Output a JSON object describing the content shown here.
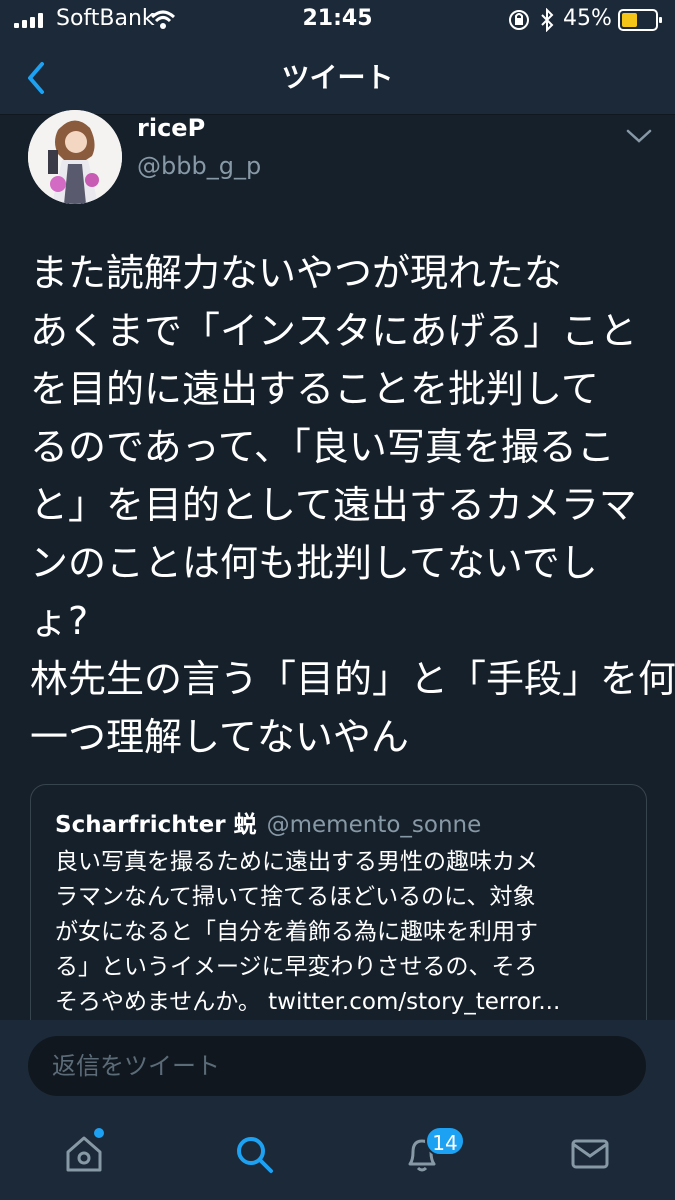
{
  "status_bar": {
    "carrier": "SoftBank",
    "time": "21:45",
    "battery": "45%"
  },
  "nav": {
    "title": "ツイート"
  },
  "tweet": {
    "display_name": "riceP",
    "handle": "@bbb_g_p",
    "lines": [
      "また読解力ないやつが現れたな",
      "あくまで「インスタにあげる」こと",
      "を目的に遠出することを批判して",
      "るのであって、「良い写真を撮るこ",
      "と」を目的として遠出するカメラマ",
      "ンのことは何も批判してないでし",
      "ょ?",
      "林先生の言う「目的」と「手段」を何",
      "一つ理解してないやん"
    ]
  },
  "quote": {
    "name": "Scharfrichter 蜕",
    "handle": "@memento_sonne",
    "lines": [
      "良い写真を撮るために遠出する男性の趣味カメ",
      "ラマンなんて掃いて捨てるほどいるのに、対象",
      "が女になると「自分を着飾る為に趣味を利用す",
      "る」というイメージに早変わりさせるの、そろ",
      "そろやめませんか。 twitter.com/story_terror..."
    ]
  },
  "composer": {
    "placeholder": "返信をツイート"
  },
  "tabs": {
    "notifications_count": "14"
  },
  "colors": {
    "background": "#15202b",
    "bar": "#1c2938",
    "accent": "#1da1f2",
    "muted": "#8899a6"
  },
  "icons": [
    "back-chevron-icon",
    "caret-down-icon",
    "home-icon",
    "search-icon",
    "bell-icon",
    "envelope-icon",
    "wifi-icon",
    "bluetooth-icon",
    "battery-icon"
  ]
}
